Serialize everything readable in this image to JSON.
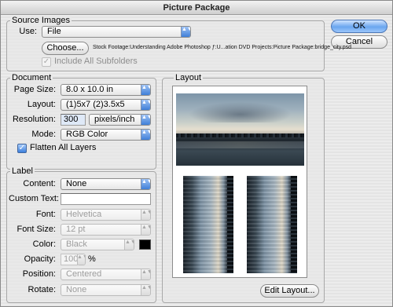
{
  "window": {
    "title": "Picture Package"
  },
  "buttons": {
    "ok": "OK",
    "cancel": "Cancel",
    "choose": "Choose...",
    "edit_layout": "Edit Layout..."
  },
  "source_images": {
    "title": "Source Images",
    "use_label": "Use:",
    "use_value": "File",
    "file_path": "Stock Footage:Understanding Adobe Photoshop ƒ:U...ation DVD Projects:Picture Package:bridge_city.psd",
    "include_subfolders_label": "Include All Subfolders",
    "include_subfolders_checked": true
  },
  "document": {
    "title": "Document",
    "page_size_label": "Page Size:",
    "page_size_value": "8.0 x 10.0 in",
    "layout_label": "Layout:",
    "layout_value": "(1)5x7 (2)3.5x5",
    "resolution_label": "Resolution:",
    "resolution_value": "300",
    "resolution_unit": "pixels/inch",
    "mode_label": "Mode:",
    "mode_value": "RGB Color",
    "flatten_label": "Flatten All Layers",
    "flatten_checked": true
  },
  "label": {
    "title": "Label",
    "content_label": "Content:",
    "content_value": "None",
    "custom_text_label": "Custom Text:",
    "custom_text_value": "",
    "font_label": "Font:",
    "font_value": "Helvetica",
    "font_size_label": "Font Size:",
    "font_size_value": "12 pt",
    "color_label": "Color:",
    "color_value": "Black",
    "color_swatch": "#000000",
    "opacity_label": "Opacity:",
    "opacity_value": "100",
    "opacity_unit": "%",
    "position_label": "Position:",
    "position_value": "Centered",
    "rotate_label": "Rotate:",
    "rotate_value": "None"
  },
  "layout": {
    "title": "Layout"
  },
  "icons": {
    "popup_arrow": "▲▼",
    "checkmark": "✓"
  }
}
